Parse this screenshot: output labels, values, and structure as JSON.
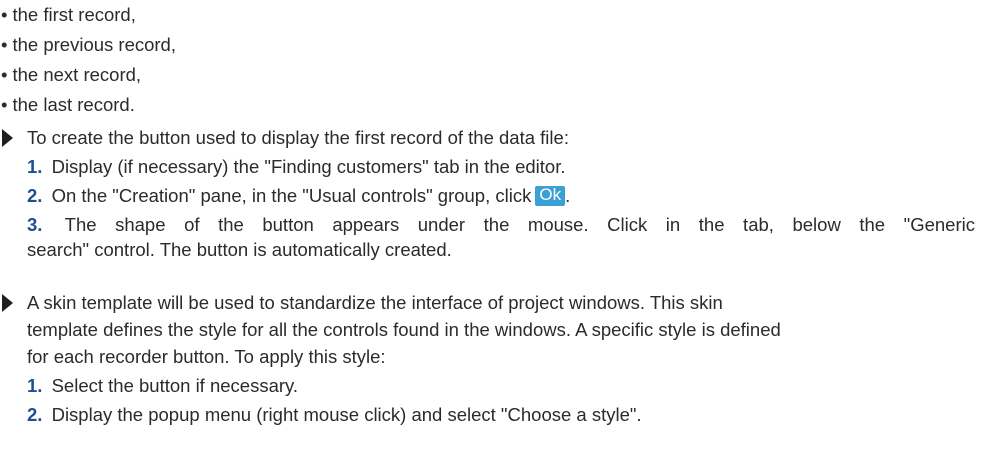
{
  "bullets": [
    "the first record,",
    "the previous record,",
    "the next record,",
    "the last record."
  ],
  "bullet_symbol": "•",
  "section1": {
    "intro": "To create the button used to display the first record of the data file:",
    "steps": [
      {
        "num": "1.",
        "text": " Display (if necessary) the \"Finding customers\" tab in the editor."
      },
      {
        "num": "2.",
        "text": " On the \"Creation\" pane, in the \"Usual controls\" group, click",
        "button": "Ok",
        "after": "."
      },
      {
        "num": "3.",
        "text": " The shape of the button appears under the mouse. Click in the tab, below the \"Generic",
        "cont": "search\" control. The button is automatically created."
      }
    ]
  },
  "section2": {
    "lines": [
      "A skin template will be used to standardize the interface of project windows. This skin",
      "template defines the style for all the controls found in the windows. A specific style is defined",
      "for each recorder button. To apply this style:"
    ],
    "steps": [
      {
        "num": "1.",
        "text": " Select the button if necessary."
      },
      {
        "num": "2.",
        "text": " Display the popup menu (right mouse click) and select \"Choose a style\"."
      }
    ]
  },
  "colors": {
    "step_number": "#1d4f8f",
    "ok_button_bg": "#3aa0d8",
    "text": "#2b2b2b"
  },
  "icons": {
    "section_marker": "triangle-right-icon"
  }
}
